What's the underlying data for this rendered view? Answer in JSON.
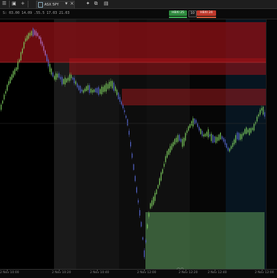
{
  "toolbar": {
    "icons": [
      "menu-icon",
      "window-icon",
      "add-icon"
    ],
    "tab_label": "ASX 5PY",
    "right_icons": [
      "settings-icon",
      "minimize-icon",
      "maximize-icon"
    ]
  },
  "info_line": "S: 03.00  14.09  .55.5  17.03  21.03",
  "trade": {
    "buy_label": "HBXI 25",
    "qty_label": "10",
    "sell_label": "HBXI 24"
  },
  "time_axis": {
    "labels": [
      "2 Nov 10:00",
      "2 Nov 10:20",
      "2 Nov 10:40",
      "2 Nov 12:00",
      "2 Nov 12:20",
      "2 Nov 12:40",
      "2 Nov 12:00"
    ]
  },
  "colors": {
    "bull": "#7ccc5e",
    "bear": "#5566cc",
    "resistance_zone": "#8a0f14",
    "support_zone": "#4a7a4a",
    "buy_btn": "#2e8b3e",
    "sell_btn": "#c0392b"
  }
}
